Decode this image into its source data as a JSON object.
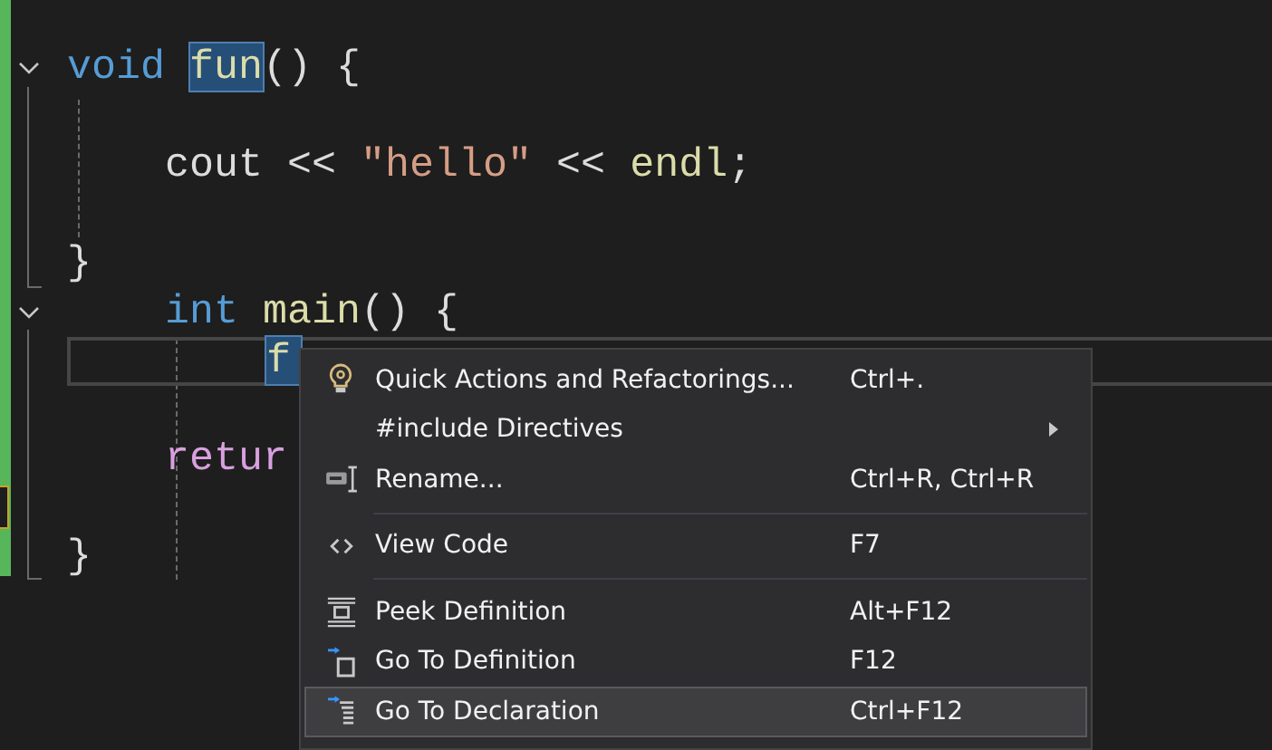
{
  "editor": {
    "lines": [
      {
        "kind": "blank"
      },
      {
        "kind": "code",
        "expanded": true,
        "tokens": [
          {
            "text": "void ",
            "kind": "keyword"
          },
          {
            "text": "fun",
            "kind": "function",
            "highlighted": true
          },
          {
            "text": "() {",
            "kind": "plain"
          }
        ]
      },
      {
        "kind": "blank"
      },
      {
        "kind": "code",
        "tokens": [
          {
            "text": "    cout << ",
            "kind": "plain"
          },
          {
            "text": "\"hello\"",
            "kind": "string"
          },
          {
            "text": " << ",
            "kind": "plain"
          },
          {
            "text": "endl",
            "kind": "function"
          },
          {
            "text": ";",
            "kind": "plain"
          }
        ]
      },
      {
        "kind": "blank"
      },
      {
        "kind": "code",
        "tokens": [
          {
            "text": "}",
            "kind": "plain"
          }
        ]
      },
      {
        "kind": "code",
        "expanded": true,
        "tokens": [
          {
            "text": "    int ",
            "kind": "keyword"
          },
          {
            "text": "main",
            "kind": "function"
          },
          {
            "text": "() {",
            "kind": "plain"
          }
        ]
      },
      {
        "kind": "code",
        "current": true,
        "tokens": [
          {
            "text": "        f",
            "kind": "function",
            "highlighted": true
          }
        ]
      },
      {
        "kind": "blank"
      },
      {
        "kind": "code",
        "tokens": [
          {
            "text": "    retur",
            "kind": "control"
          }
        ]
      },
      {
        "kind": "blank"
      },
      {
        "kind": "code",
        "tokens": [
          {
            "text": "}",
            "kind": "plain"
          }
        ]
      }
    ]
  },
  "context_menu": {
    "items": [
      {
        "kind": "item",
        "label": "Quick Actions and Refactorings...",
        "shortcut": "Ctrl+.",
        "submenu": false,
        "selected": false
      },
      {
        "kind": "item",
        "label": "#include Directives",
        "submenu": true,
        "selected": false
      },
      {
        "kind": "item",
        "label": "Rename...",
        "shortcut": "Ctrl+R, Ctrl+R",
        "submenu": false,
        "selected": false
      },
      {
        "kind": "separator"
      },
      {
        "kind": "item",
        "label": "View Code",
        "shortcut": "F7",
        "submenu": false,
        "selected": false
      },
      {
        "kind": "separator"
      },
      {
        "kind": "item",
        "label": "Peek Definition",
        "shortcut": "Alt+F12",
        "submenu": false,
        "selected": false
      },
      {
        "kind": "item",
        "label": "Go To Definition",
        "shortcut": "F12",
        "submenu": false,
        "selected": false
      },
      {
        "kind": "item",
        "label": "Go To Declaration",
        "shortcut": "Ctrl+F12",
        "submenu": false,
        "selected": true
      }
    ]
  }
}
